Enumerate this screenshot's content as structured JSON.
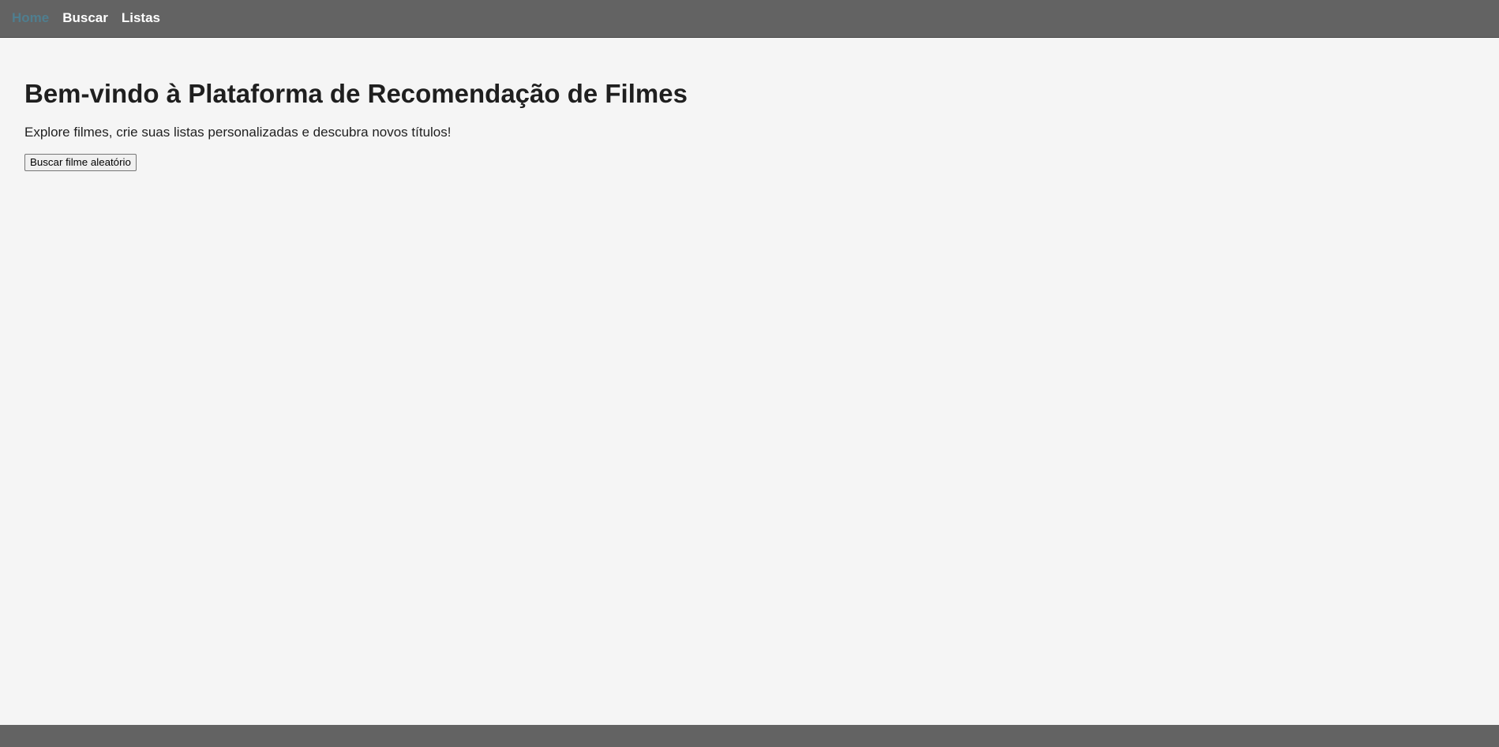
{
  "nav": {
    "items": [
      {
        "label": "Home",
        "active": true
      },
      {
        "label": "Buscar",
        "active": false
      },
      {
        "label": "Listas",
        "active": false
      }
    ]
  },
  "main": {
    "title": "Bem-vindo à Plataforma de Recomendação de Filmes",
    "intro": "Explore filmes, crie suas listas personalizadas e descubra novos títulos!",
    "random_button_label": "Buscar filme aleatório"
  },
  "colors": {
    "nav_background": "#636363",
    "nav_active": "#4f7e8f",
    "page_background": "#f5f5f5"
  }
}
